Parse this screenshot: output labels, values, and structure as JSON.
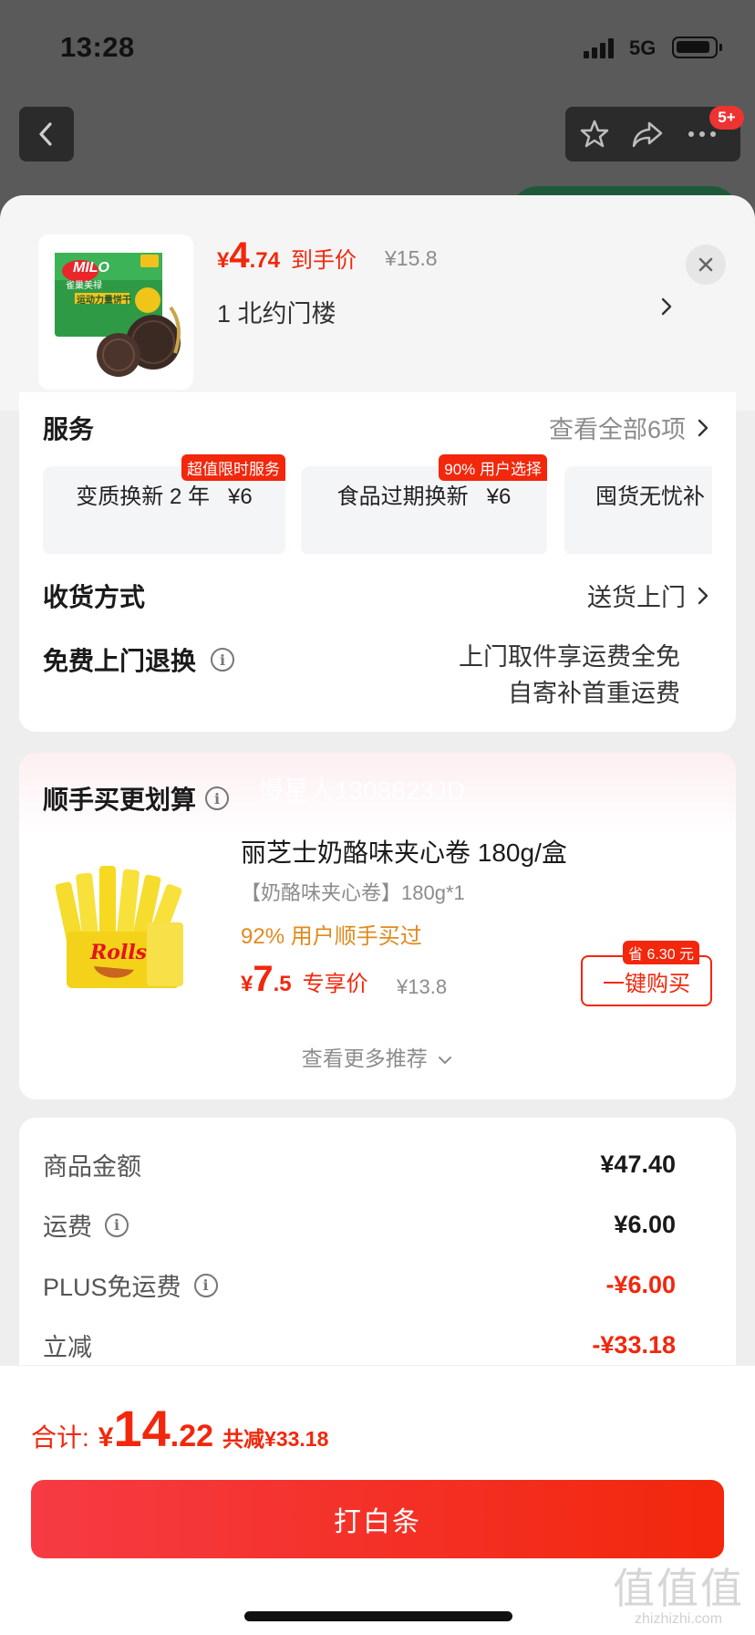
{
  "status_bar": {
    "time": "13:28",
    "network": "5G"
  },
  "nav": {
    "badge": "5+"
  },
  "product": {
    "price_currency": "¥",
    "price_int": "4",
    "price_dec": ".74",
    "price_label": "到手价",
    "original_price": "¥15.8",
    "address": "1  北约门楼",
    "image_brand": "MILO",
    "image_brand_cn": "雀巢美禄",
    "image_caption": "运动力量饼干"
  },
  "services": {
    "title": "服务",
    "view_all": "查看全部6项",
    "items": [
      {
        "label": "变质换新 2 年",
        "price": "¥6",
        "badge": "超值限时服务"
      },
      {
        "label": "食品过期换新",
        "price": "¥6",
        "badge": "90% 用户选择"
      },
      {
        "label": "囤货无忧补",
        "price": "",
        "badge": ""
      }
    ]
  },
  "delivery": {
    "title": "收货方式",
    "value": "送货上门"
  },
  "returns": {
    "title": "免费上门退换",
    "line1": "上门取件享运费全免",
    "line2": "自寄补首重运费"
  },
  "upsell": {
    "title": "顺手买更划算",
    "watermark": "慢星人1308823JD",
    "product_name": "丽芝士奶酪味夹心卷 180g/盒",
    "spec": "【奶酪味夹心卷】180g*1",
    "social_proof": "92% 用户顺手买过",
    "price_currency": "¥",
    "price_int": "7",
    "price_dec": ".5",
    "price_label": "专享价",
    "original_price": "¥13.8",
    "save_tag": "省 6.30 元",
    "buy_button": "一键购买",
    "more": "查看更多推荐",
    "image_brand": "Rolls"
  },
  "summary": [
    {
      "label": "商品金额",
      "value": "¥47.40",
      "info": false,
      "red": false
    },
    {
      "label": "运费",
      "value": "¥6.00",
      "info": true,
      "red": false
    },
    {
      "label": "PLUS免运费",
      "value": "-¥6.00",
      "info": true,
      "red": true
    },
    {
      "label": "立减",
      "value": "-¥33.18",
      "info": false,
      "red": true
    }
  ],
  "footer": {
    "total_label": "合计:",
    "currency": "¥",
    "total_int": "14",
    "total_dec": ".22",
    "saved": "共减¥33.18",
    "pay_button": "打白条",
    "watermark_text": "值",
    "watermark_site": "zhizhizhi.com"
  },
  "colors": {
    "accent": "#f2270c",
    "orange": "#e08a1c",
    "muted": "#8c8c8c"
  }
}
